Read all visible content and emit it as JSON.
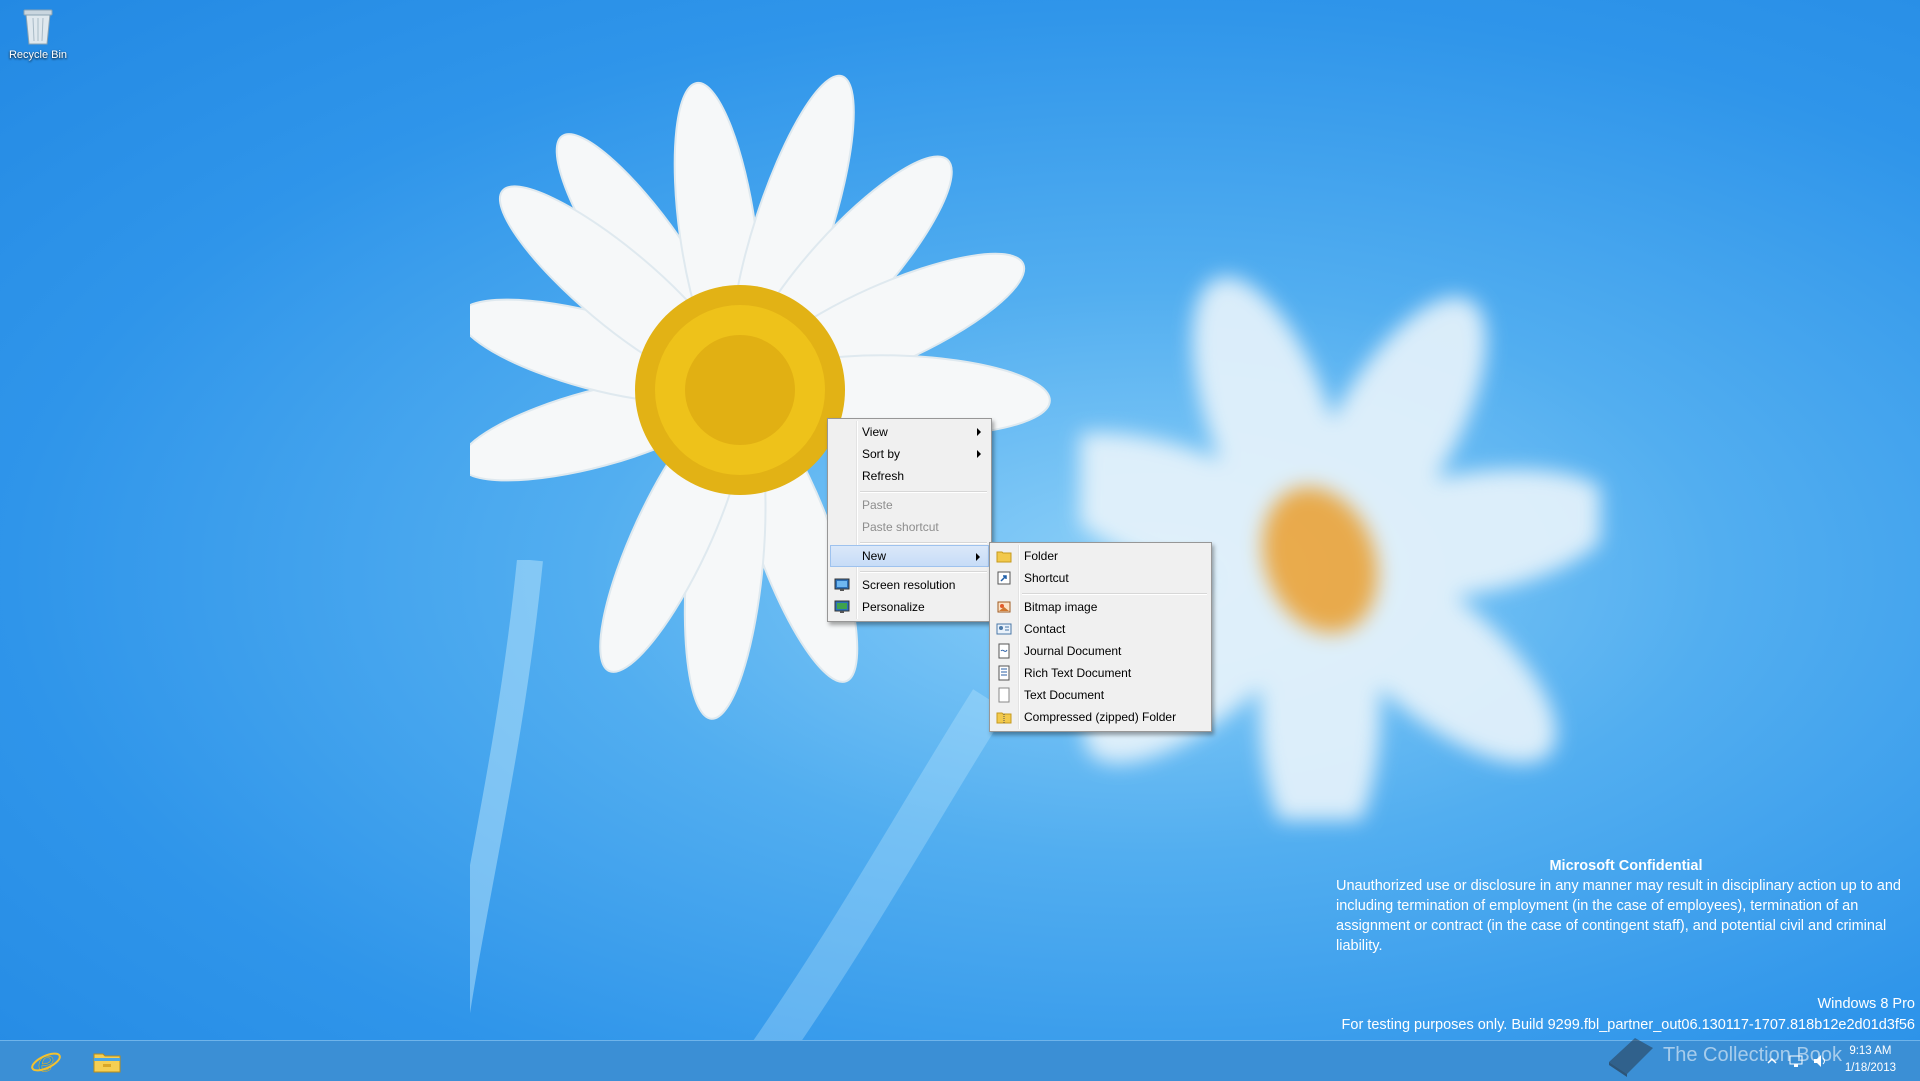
{
  "desktop": {
    "icons": [
      {
        "label": "Recycle Bin",
        "icon": "recycle-bin-icon"
      }
    ]
  },
  "context_menu": {
    "items": [
      {
        "label": "View",
        "submenu": true,
        "enabled": true
      },
      {
        "label": "Sort by",
        "submenu": true,
        "enabled": true
      },
      {
        "label": "Refresh",
        "submenu": false,
        "enabled": true
      },
      {
        "label": "Paste",
        "submenu": false,
        "enabled": false
      },
      {
        "label": "Paste shortcut",
        "submenu": false,
        "enabled": false
      },
      {
        "label": "New",
        "submenu": true,
        "enabled": true,
        "highlighted": true
      },
      {
        "label": "Screen resolution",
        "submenu": false,
        "enabled": true,
        "icon": "screen-resolution-icon"
      },
      {
        "label": "Personalize",
        "submenu": false,
        "enabled": true,
        "icon": "personalize-icon"
      }
    ]
  },
  "new_submenu": {
    "items": [
      {
        "label": "Folder",
        "icon": "folder-icon"
      },
      {
        "label": "Shortcut",
        "icon": "shortcut-icon"
      },
      {
        "label": "Bitmap image",
        "icon": "bitmap-icon"
      },
      {
        "label": "Contact",
        "icon": "contact-icon"
      },
      {
        "label": "Journal Document",
        "icon": "journal-icon"
      },
      {
        "label": "Rich Text Document",
        "icon": "rich-text-icon"
      },
      {
        "label": "Text Document",
        "icon": "text-document-icon"
      },
      {
        "label": "Compressed (zipped) Folder",
        "icon": "zip-folder-icon"
      }
    ]
  },
  "notice": {
    "title": "Microsoft Confidential",
    "body": "Unauthorized use or disclosure in any manner may result in disciplinary action up to and including termination of employment (in the case of employees), termination of an assignment or contract (in the case of contingent staff), and potential civil and criminal liability."
  },
  "watermark": {
    "edition": "Windows 8 Pro",
    "build": "For testing purposes only. Build 9299.fbl_partner_out06.130117-1707.818b12e2d01d3f56"
  },
  "taskbar": {
    "pinned": [
      {
        "name": "Internet Explorer",
        "icon": "internet-explorer-icon"
      },
      {
        "name": "File Explorer",
        "icon": "file-explorer-icon"
      }
    ],
    "clock_time": "9:13 AM",
    "clock_date": "1/18/2013",
    "brand_text": "The Collection Book"
  },
  "colors": {
    "desktop_blue": "#2f95ea",
    "menu_bg": "#f0f0f0",
    "menu_highlight": "#c7dcf7",
    "taskbar": "#3b8fd5"
  }
}
